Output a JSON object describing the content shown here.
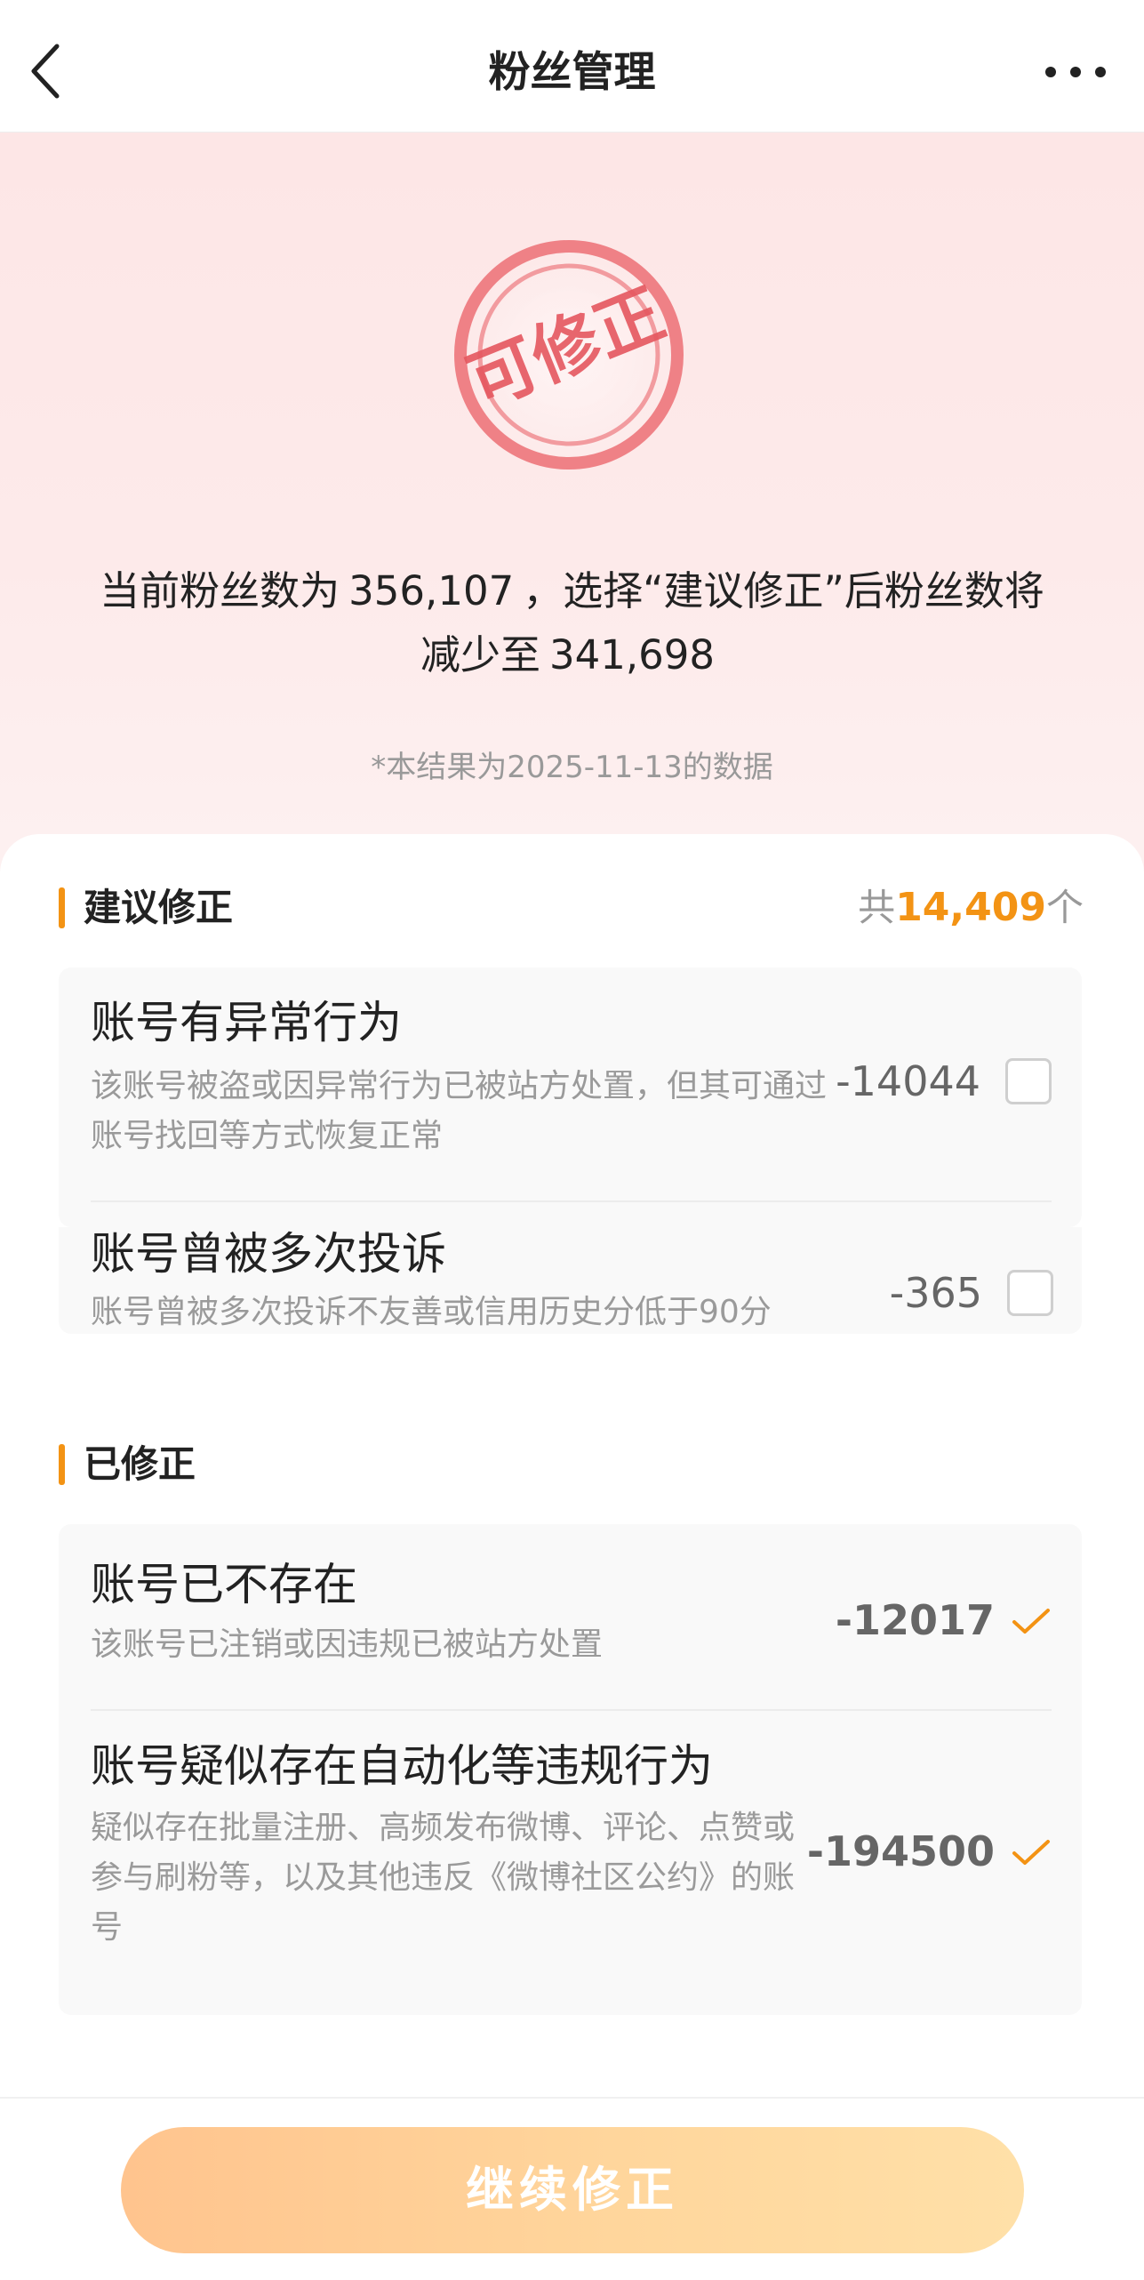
{
  "nav": {
    "title": "粉丝管理",
    "back_icon": "chevron-left-icon",
    "more_icon": "more-horizontal-icon"
  },
  "hero": {
    "stamp_text": "可修正",
    "summary_prefix": "当前粉丝数为",
    "current_fans": "356,107",
    "summary_middle": "，选择“建议修正”后粉丝数将减少至",
    "after_fans": "341,698",
    "date_note": "*本结果为2025-11-13的数据"
  },
  "suggested": {
    "title": "建议修正",
    "count_prefix": "共",
    "count": "14,409",
    "count_suffix": "个",
    "items": [
      {
        "title": "账号有异常行为",
        "desc": "该账号被盗或因异常行为已被站方处置，但其可通过账号找回等方式恢复正常",
        "value": "-14044",
        "checked": false
      },
      {
        "title": "账号曾被多次投诉",
        "desc": "账号曾被多次投诉不友善或信用历史分低于90分",
        "value": "-365",
        "checked": false
      }
    ]
  },
  "corrected": {
    "title": "已修正",
    "items": [
      {
        "title": "账号已不存在",
        "desc": "该账号已注销或因违规已被站方处置",
        "value": "-12017",
        "status_icon": "check-icon"
      },
      {
        "title": "账号疑似存在自动化等违规行为",
        "desc": "疑似存在批量注册、高频发布微博、评论、点赞或参与刷粉等，以及其他违反《微博社区公约》的账号",
        "value": "-194500",
        "status_icon": "check-icon"
      }
    ]
  },
  "cta": {
    "label": "继续修正"
  },
  "colors": {
    "accent": "#f39314",
    "stamp": "#e5575f",
    "cta_start": "#ffc48e",
    "cta_end": "#ffe0a8",
    "hero_bg": "#fde6e6"
  }
}
